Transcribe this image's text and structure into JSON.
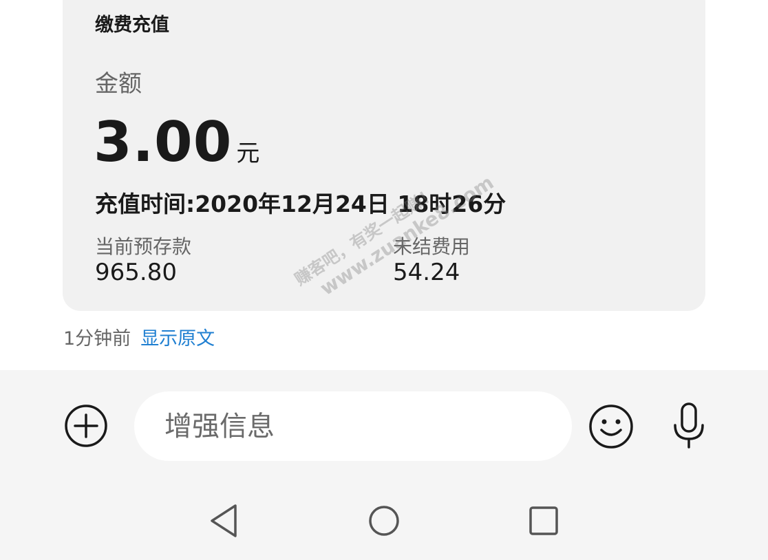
{
  "card": {
    "title": "缴费充值",
    "amount_label": "金额",
    "amount_value": "3.00",
    "amount_unit": "元",
    "recharge_time": "充值时间:2020年12月24日 18时26分",
    "stats": [
      {
        "label": "当前预存款",
        "value": "965.80"
      },
      {
        "label": "未结费用",
        "value": "54.24"
      }
    ]
  },
  "meta": {
    "time_ago": "1分钟前",
    "show_original": "显示原文"
  },
  "watermark": {
    "line1": "赚客吧，有奖一起赚！",
    "line2": "www.zuanke8.com"
  },
  "input_bar": {
    "placeholder": "增强信息",
    "value": "",
    "icons": [
      "plus-circle-icon",
      "emoji-icon",
      "microphone-icon"
    ]
  },
  "nav_bar": {
    "icons": [
      "back-triangle-icon",
      "home-circle-icon",
      "recent-square-icon"
    ]
  },
  "colors": {
    "card_bg": "#f1f1f1",
    "link": "#1f7fd1",
    "input_bar_bg": "#f5f5f5"
  }
}
